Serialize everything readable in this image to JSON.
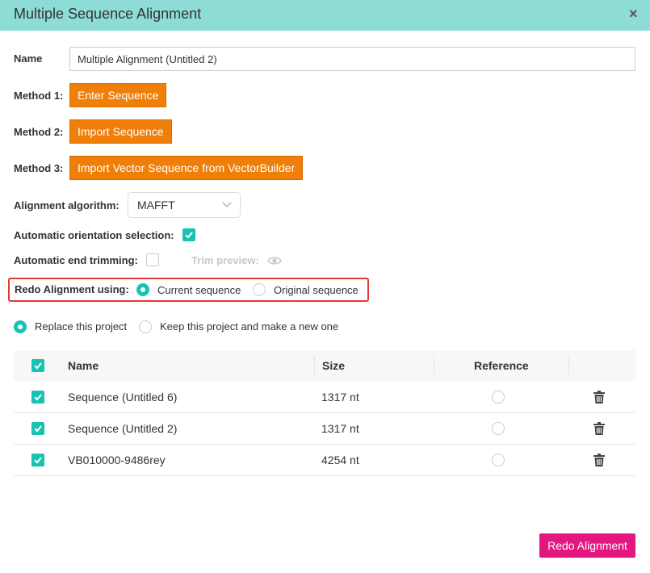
{
  "dialog": {
    "title": "Multiple Sequence Alignment",
    "close_glyph": "×"
  },
  "name": {
    "label": "Name",
    "value": "Multiple Alignment (Untitled 2)"
  },
  "methods": [
    {
      "label": "Method 1:",
      "button": "Enter Sequence"
    },
    {
      "label": "Method 2:",
      "button": "Import Sequence"
    },
    {
      "label": "Method 3:",
      "button": "Import Vector Sequence from VectorBuilder"
    }
  ],
  "algorithm": {
    "label": "Alignment algorithm:",
    "value": "MAFFT"
  },
  "orientation": {
    "label": "Automatic orientation selection:",
    "checked": true
  },
  "trimming": {
    "label": "Automatic end trimming:",
    "checked": false,
    "preview_label": "Trim preview:"
  },
  "redo_using": {
    "label": "Redo Alignment using:",
    "options": [
      "Current sequence",
      "Original sequence"
    ],
    "selected": "Current sequence"
  },
  "project": {
    "options": [
      "Replace this project",
      "Keep this project and make a new one"
    ],
    "selected": "Replace this project"
  },
  "table": {
    "headers": {
      "name": "Name",
      "size": "Size",
      "reference": "Reference"
    },
    "rows": [
      {
        "name": "Sequence (Untitled 6)",
        "size": "1317 nt",
        "checked": true
      },
      {
        "name": "Sequence (Untitled 2)",
        "size": "1317 nt",
        "checked": true
      },
      {
        "name": "VB010000-9486rey",
        "size": "4254 nt",
        "checked": true
      }
    ]
  },
  "footer": {
    "redo_button": "Redo Alignment"
  },
  "colors": {
    "header": "#8ddcd5",
    "orange": "#f07f09",
    "teal": "#16c3b3",
    "highlight": "#e53935",
    "redo": "#e4167f"
  }
}
